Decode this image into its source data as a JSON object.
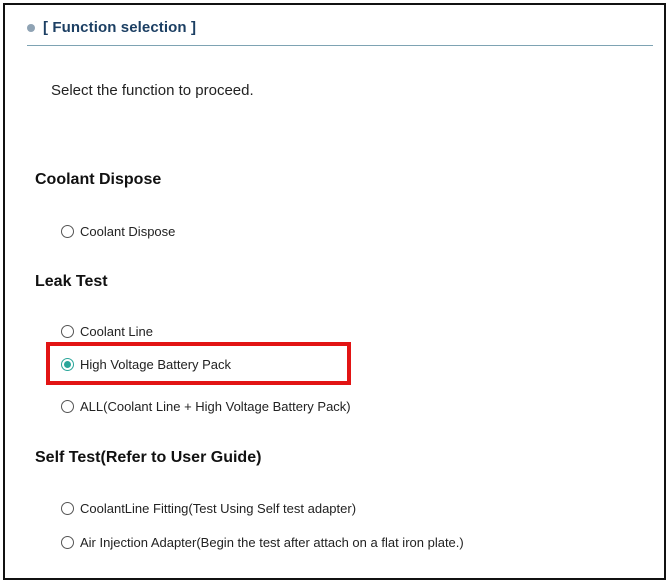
{
  "header": {
    "title": "[ Function selection ]"
  },
  "instruction": "Select the function to proceed.",
  "sections": [
    {
      "title": "Coolant Dispose",
      "options": [
        {
          "label": "Coolant Dispose",
          "selected": false
        }
      ]
    },
    {
      "title": "Leak Test",
      "options": [
        {
          "label": "Coolant Line",
          "selected": false
        },
        {
          "label": "High Voltage Battery Pack",
          "selected": true
        },
        {
          "label": "ALL(Coolant Line + High Voltage Battery Pack)",
          "selected": false
        }
      ]
    },
    {
      "title": "Self Test(Refer to User Guide)",
      "options": [
        {
          "label": "CoolantLine Fitting(Test Using Self test adapter)",
          "selected": false
        },
        {
          "label": "Air Injection Adapter(Begin the test after attach on a flat iron plate.)",
          "selected": false
        }
      ]
    }
  ],
  "colors": {
    "accent": "#2aa69a",
    "highlight": "#e21414",
    "header_text": "#1c3f63"
  }
}
